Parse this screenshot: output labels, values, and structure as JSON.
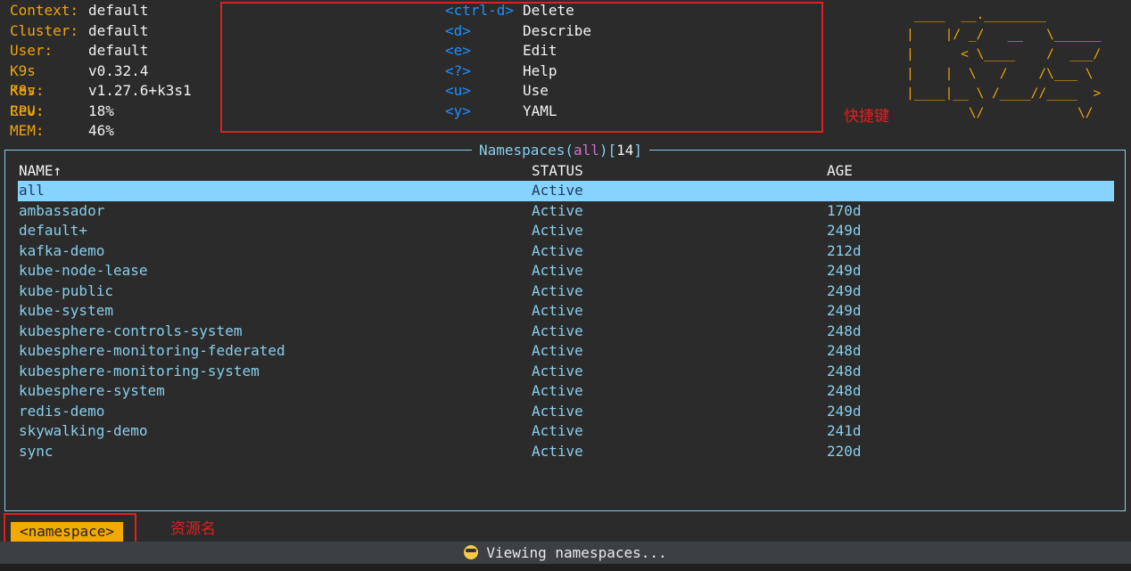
{
  "info": [
    {
      "label": "Context:",
      "value": "default"
    },
    {
      "label": "Cluster:",
      "value": "default"
    },
    {
      "label": "User:",
      "value": "default"
    },
    {
      "label": "K9s Rev:",
      "value": "v0.32.4"
    },
    {
      "label": "K8s Rev:",
      "value": "v1.27.6+k3s1"
    },
    {
      "label": "CPU:",
      "value": "18%"
    },
    {
      "label": "MEM:",
      "value": "46%"
    }
  ],
  "shortcuts": [
    {
      "key": "<ctrl-d>",
      "desc": "Delete"
    },
    {
      "key": "<d>",
      "desc": "Describe"
    },
    {
      "key": "<e>",
      "desc": "Edit"
    },
    {
      "key": "<?>",
      "desc": "Help"
    },
    {
      "key": "<u>",
      "desc": "Use"
    },
    {
      "key": "<y>",
      "desc": "YAML"
    }
  ],
  "logo": [
    " ____  __.________",
    "|    |/ _/   __   \\______",
    "|      < \\____    /  ___/",
    "|    |  \\   /    /\\___ \\",
    "|____|__ \\ /____//____  >",
    "        \\/            \\/"
  ],
  "annotations": {
    "shortcuts_label": "快捷键",
    "resource_label": "资源名"
  },
  "table": {
    "title_prefix": "Namespaces(",
    "title_filter": "all",
    "title_mid": ")[",
    "title_count": "14",
    "title_suffix": "]",
    "headers": {
      "name": "NAME↑",
      "status": "STATUS",
      "age": "AGE"
    },
    "rows": [
      {
        "name": "all",
        "status": "Active",
        "age": ""
      },
      {
        "name": "ambassador",
        "status": "Active",
        "age": "170d"
      },
      {
        "name": "default+",
        "status": "Active",
        "age": "249d"
      },
      {
        "name": "kafka-demo",
        "status": "Active",
        "age": "212d"
      },
      {
        "name": "kube-node-lease",
        "status": "Active",
        "age": "249d"
      },
      {
        "name": "kube-public",
        "status": "Active",
        "age": "249d"
      },
      {
        "name": "kube-system",
        "status": "Active",
        "age": "249d"
      },
      {
        "name": "kubesphere-controls-system",
        "status": "Active",
        "age": "248d"
      },
      {
        "name": "kubesphere-monitoring-federated",
        "status": "Active",
        "age": "248d"
      },
      {
        "name": "kubesphere-monitoring-system",
        "status": "Active",
        "age": "248d"
      },
      {
        "name": "kubesphere-system",
        "status": "Active",
        "age": "248d"
      },
      {
        "name": "redis-demo",
        "status": "Active",
        "age": "249d"
      },
      {
        "name": "skywalking-demo",
        "status": "Active",
        "age": "241d"
      },
      {
        "name": "sync",
        "status": "Active",
        "age": "220d"
      }
    ]
  },
  "crumb": "<namespace>",
  "status": {
    "icon": "sunglasses-emoji-icon",
    "text": "Viewing namespaces..."
  }
}
